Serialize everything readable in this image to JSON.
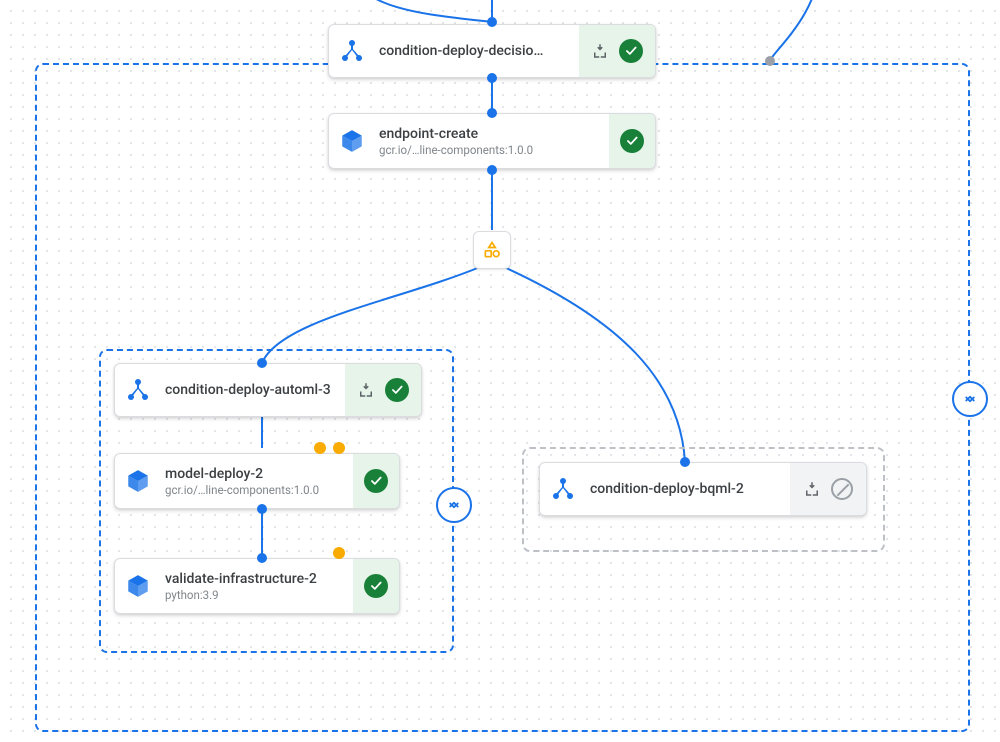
{
  "nodes": {
    "decision": {
      "title": "condition-deploy-decisio…"
    },
    "endpoint": {
      "title": "endpoint-create",
      "sub": "gcr.io/…line-components:1.0.0"
    },
    "automl": {
      "title": "condition-deploy-automl-3"
    },
    "modelDeploy": {
      "title": "model-deploy-2",
      "sub": "gcr.io/…line-components:1.0.0"
    },
    "validate": {
      "title": "validate-infrastructure-2",
      "sub": "python:3.9"
    },
    "bqml": {
      "title": "condition-deploy-bqml-2"
    }
  },
  "iconNames": {
    "branch": "branch-icon",
    "cube": "cube-icon",
    "fork": "fork-shapes-icon",
    "expand": "expand-icon",
    "check": "check-icon",
    "skip": "skip-icon",
    "collapse": "collapse-icon"
  }
}
